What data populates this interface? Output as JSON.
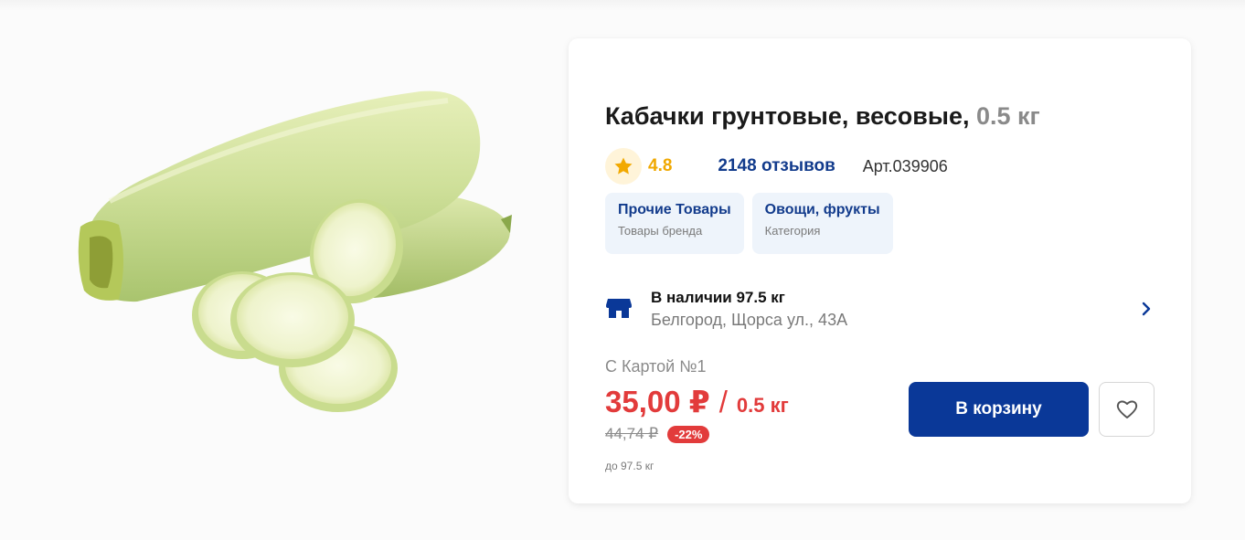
{
  "product": {
    "title": "Кабачки грунтовые, весовые,",
    "weight": "0.5 кг",
    "rating": "4.8",
    "reviews": "2148 отзывов",
    "article": "Арт.039906",
    "image_icon": "zucchini-image"
  },
  "chips": [
    {
      "title": "Прочие Товары",
      "subtitle": "Товары бренда"
    },
    {
      "title": "Овощи, фрукты",
      "subtitle": "Категория"
    }
  ],
  "stock": {
    "title": "В наличии 97.5 кг",
    "address": "Белгород, Щорса ул., 43А",
    "icon": "store-icon"
  },
  "pricing": {
    "card_label": "С Картой №1",
    "price": "35,00 ₽",
    "separator": "/",
    "unit": "0.5 кг",
    "old_price": "44,74 ₽",
    "discount": "-22%",
    "limit": "до 97.5 кг"
  },
  "actions": {
    "cart_label": "В корзину",
    "favorite_icon": "heart-icon"
  },
  "colors": {
    "accent": "#0a3898",
    "price": "#e23b3b",
    "rating": "#f0a800",
    "chip_bg": "#eef4fb"
  }
}
